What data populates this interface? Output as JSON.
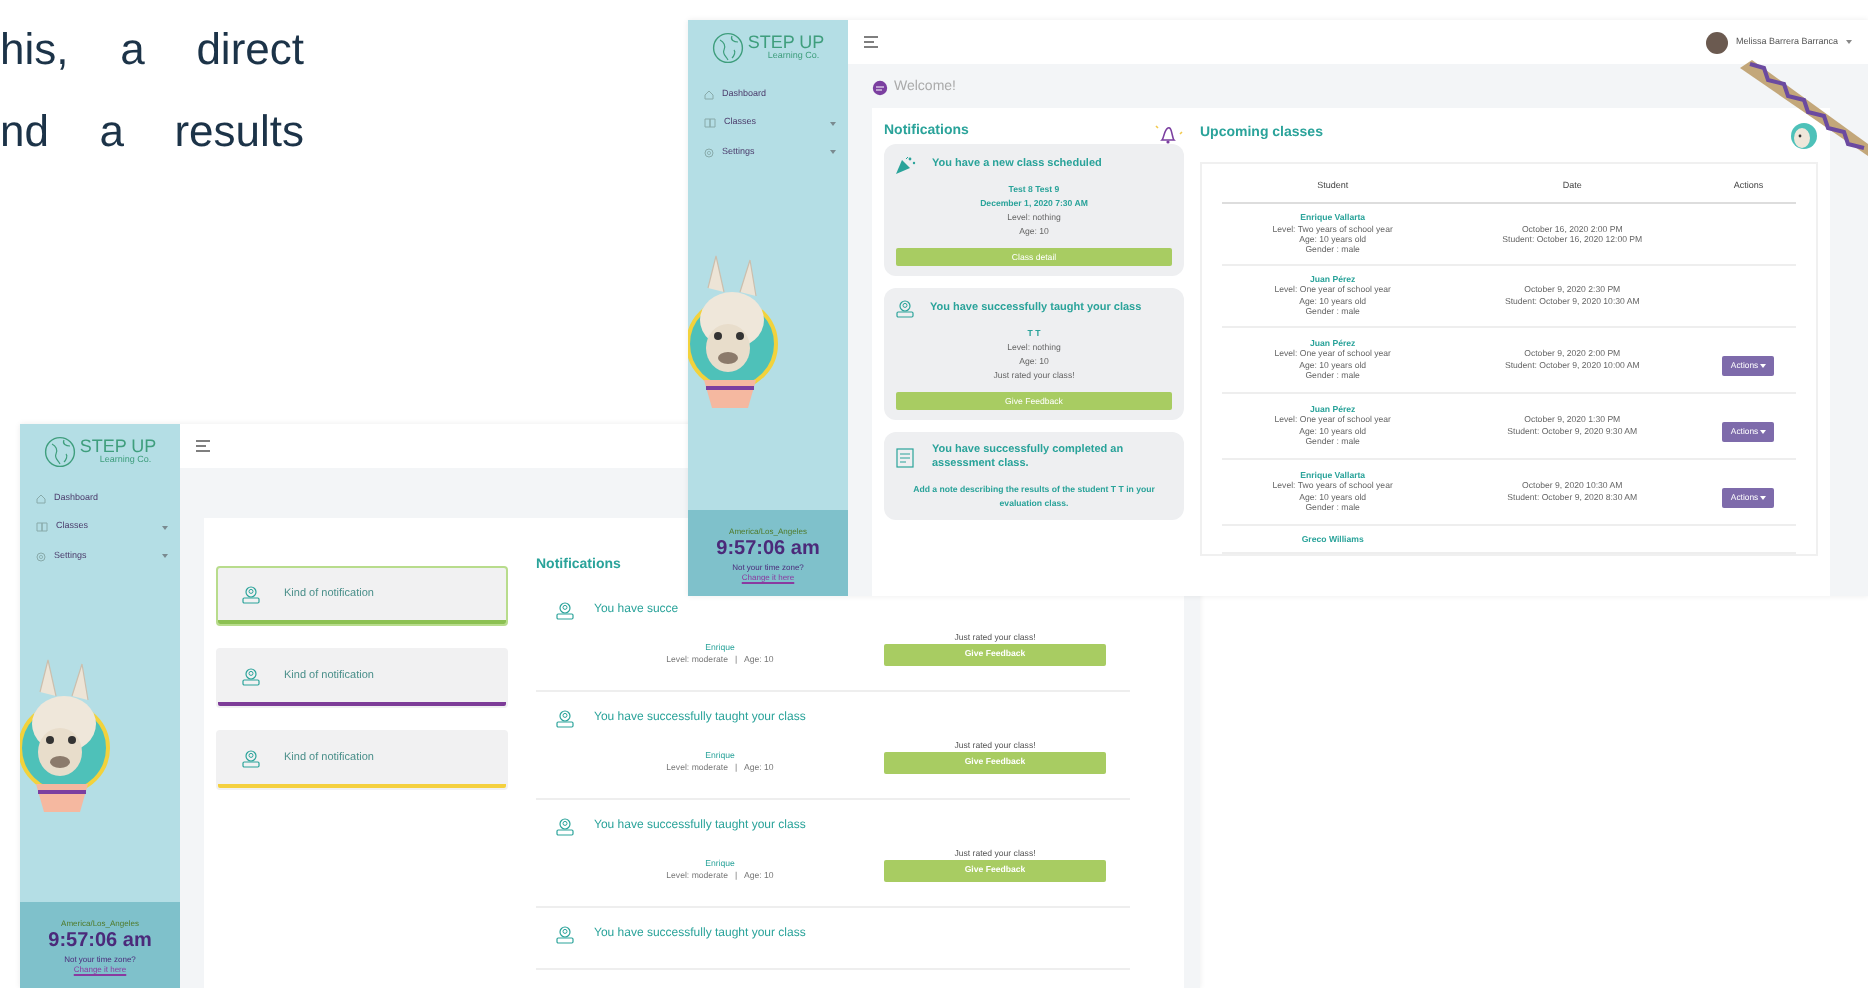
{
  "intro": {
    "lines": [
      "his, a direct",
      "nd a results"
    ]
  },
  "list_view": {
    "sidebar": {
      "logo": {
        "title": "STEP UP",
        "subtitle": "Learning Co."
      },
      "items": [
        {
          "label": "Dashboard",
          "expandable": false
        },
        {
          "label": "Classes",
          "expandable": true
        },
        {
          "label": "Settings",
          "expandable": true
        }
      ],
      "clock": {
        "timezone": "America/Los_Angeles",
        "time": "9:57:06 am",
        "prompt": "Not your time zone?",
        "link": "Change it here"
      }
    },
    "kind_cards": [
      {
        "label": "Kind of notification",
        "color": "#8cc152",
        "selected": true
      },
      {
        "label": "Kind of notification",
        "color": "#7d3c98",
        "selected": false
      },
      {
        "label": "Kind of notification",
        "color": "#f4d03f",
        "selected": false
      }
    ],
    "notifications_title": "Notifications",
    "notifications": [
      {
        "title": "You have succe",
        "name": "Enrique",
        "details": "Level: moderate   |   Age: 10",
        "rating": "Just rated your class!",
        "button": "Give Feedback"
      },
      {
        "title": "You have successfully taught your class",
        "name": "Enrique",
        "details": "Level: moderate   |   Age: 10",
        "rating": "Just rated your class!",
        "button": "Give Feedback"
      },
      {
        "title": "You have successfully taught your class",
        "name": "Enrique",
        "details": "Level: moderate   |   Age: 10",
        "rating": "Just rated your class!",
        "button": "Give Feedback"
      },
      {
        "title": "You have successfully taught your class"
      }
    ]
  },
  "home_view": {
    "sidebar": {
      "logo": {
        "title": "STEP UP",
        "subtitle": "Learning Co."
      },
      "items": [
        {
          "label": "Dashboard",
          "expandable": false
        },
        {
          "label": "Classes",
          "expandable": true
        },
        {
          "label": "Settings",
          "expandable": true
        }
      ],
      "clock": {
        "timezone": "America/Los_Angeles",
        "time": "9:57:06 am",
        "prompt": "Not your time zone?",
        "link": "Change it here"
      }
    },
    "user": "Melissa Barrera Barranca",
    "welcome": "Welcome!",
    "notifications_title": "Notifications",
    "notifications": [
      {
        "kind": "scheduled",
        "title": "You have a new class scheduled",
        "lines": [
          {
            "text": "Test 8 Test 9",
            "emphasis": true
          },
          {
            "text": "December 1, 2020 7:30 AM",
            "emphasis": true
          },
          {
            "text": "Level: nothing",
            "emphasis": false
          },
          {
            "text": "Age: 10",
            "emphasis": false
          }
        ],
        "button": "Class detail"
      },
      {
        "kind": "taught",
        "title": "You have successfully taught your class",
        "lines": [
          {
            "text": "T T",
            "emphasis": true
          },
          {
            "text": "Level: nothing",
            "emphasis": false
          },
          {
            "text": "Age: 10",
            "emphasis": false
          },
          {
            "text": "Just rated your class!",
            "emphasis": false
          }
        ],
        "button": "Give Feedback"
      },
      {
        "kind": "assessment",
        "title": "You have successfully completed an assessment class.",
        "note": "Add a note describing the results of the student T T in your evaluation class."
      }
    ],
    "upcoming_title": "Upcoming classes",
    "columns": [
      "Student",
      "Date",
      "Actions"
    ],
    "rows": [
      {
        "student": [
          "Enrique Vallarta",
          "Level: Two years of school year",
          "Age: 10 years old",
          "Gender : male"
        ],
        "date": [
          "October 16, 2020 2:00 PM",
          "Student: October 16, 2020 12:00 PM"
        ]
      },
      {
        "student": [
          "Juan Pérez",
          "Level: One year of school year",
          "Age: 10 years old",
          "Gender : male"
        ],
        "date": [
          "October 9, 2020 2:30 PM",
          "Student: October 9, 2020 10:30 AM"
        ]
      },
      {
        "student": [
          "Juan Pérez",
          "Level: One year of school year",
          "Age: 10 years old",
          "Gender : male"
        ],
        "date": [
          "October 9, 2020 2:00 PM",
          "Student: October 9, 2020 10:00 AM"
        ],
        "action": "Actions"
      },
      {
        "student": [
          "Juan Pérez",
          "Level: One year of school year",
          "Age: 10 years old",
          "Gender : male"
        ],
        "date": [
          "October 9, 2020 1:30 PM",
          "Student: October 9, 2020 9:30 AM"
        ],
        "action": "Actions"
      },
      {
        "student": [
          "Enrique Vallarta",
          "Level: Two years of school year",
          "Age: 10 years old",
          "Gender : male"
        ],
        "date": [
          "October 9, 2020 10:30 AM",
          "Student: October 9, 2020 8:30 AM"
        ],
        "action": "Actions"
      },
      {
        "student": [
          "Greco Williams"
        ],
        "date": []
      }
    ]
  }
}
